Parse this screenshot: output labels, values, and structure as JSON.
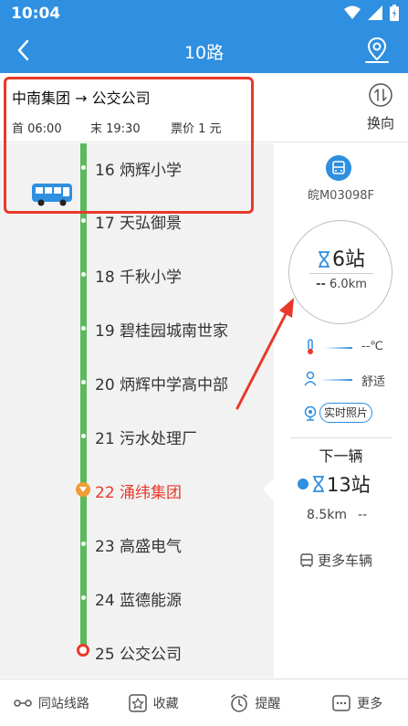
{
  "status_bar": {
    "time": "10:04"
  },
  "header": {
    "title": "10路"
  },
  "route": {
    "name": "中南集团 → 公交公司",
    "first": "首 06:00",
    "last": "末 19:30",
    "fare": "票价 1 元",
    "switch_label": "换向"
  },
  "stops": [
    {
      "name": "16 炳辉小学"
    },
    {
      "name": "17 天弘御景"
    },
    {
      "name": "18 千秋小学"
    },
    {
      "name": "19 碧桂园城南世家"
    },
    {
      "name": "20 炳辉中学高中部"
    },
    {
      "name": "21 污水处理厂"
    },
    {
      "name": "22 涌纬集团",
      "current": true
    },
    {
      "name": "23 高盛电气"
    },
    {
      "name": "24 蓝德能源"
    },
    {
      "name": "25 公交公司",
      "end": true
    }
  ],
  "vehicle": {
    "plate": "皖M03098F",
    "eta_stops": "6站",
    "eta_dist_dash": "--",
    "eta_dist": "6.0km",
    "temperature": "--℃",
    "comfort": "舒适",
    "photo_label": "实时照片"
  },
  "next_vehicle": {
    "title": "下一辆",
    "stops": "13站",
    "dist": "8.5km",
    "dist_dash": "--",
    "more_label": "更多车辆"
  },
  "bottom_nav": {
    "same_station": "同站线路",
    "favorite": "收藏",
    "reminder": "提醒",
    "more": "更多"
  },
  "colors": {
    "primary": "#2f8fe0",
    "route_line": "#5cb85c",
    "highlight": "#e8392b",
    "current_marker": "#f39c35"
  }
}
